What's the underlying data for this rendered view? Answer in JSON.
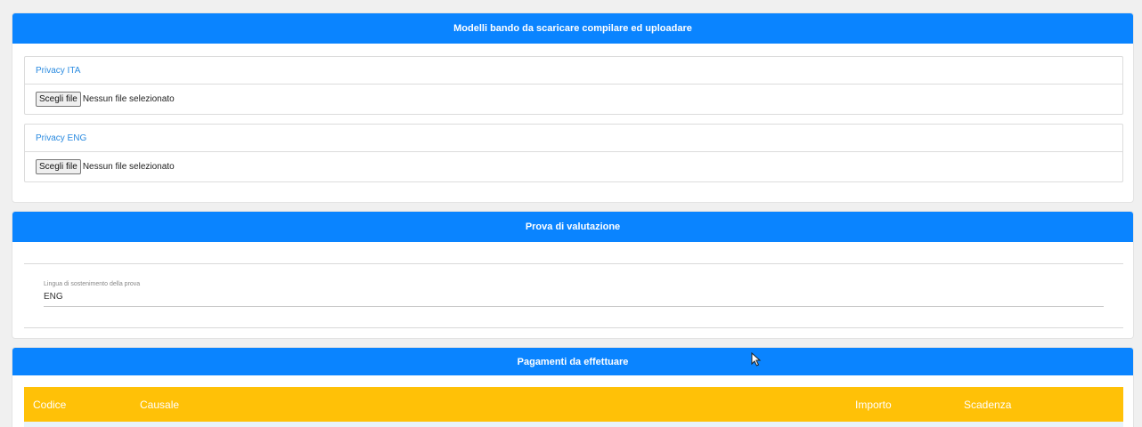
{
  "section_models": {
    "title": "Modelli bando da scaricare compilare ed uploadare",
    "uploads": [
      {
        "label": "Privacy ITA",
        "button": "Scegli file",
        "status": "Nessun file selezionato"
      },
      {
        "label": "Privacy ENG",
        "button": "Scegli file",
        "status": "Nessun file selezionato"
      }
    ]
  },
  "section_exam": {
    "title": "Prova di valutazione",
    "language_label": "Lingua di sostenimento della prova",
    "language_value": "ENG"
  },
  "section_payments": {
    "title": "Pagamenti da effettuare",
    "columns": [
      "Codice",
      "Causale",
      "Importo",
      "Scadenza"
    ]
  },
  "colors": {
    "header_blue": "#0a84ff",
    "table_header_yellow": "#ffc107",
    "link_blue": "#2b8be0"
  },
  "icons": [
    "mouse-cursor-icon"
  ]
}
